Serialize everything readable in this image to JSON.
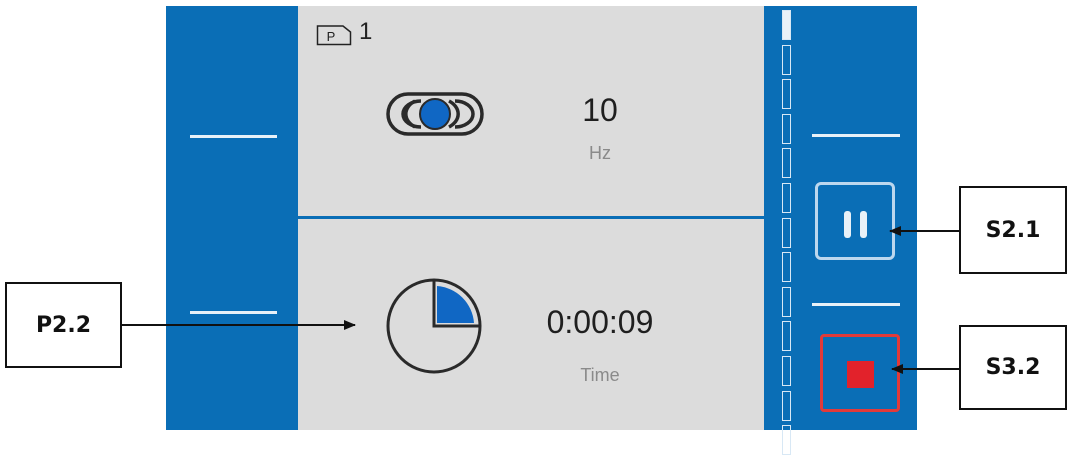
{
  "program": {
    "number": "1",
    "icon": "program-folder-icon",
    "icon_letter": "P"
  },
  "frequency": {
    "value": "10",
    "unit": "Hz",
    "icon": "vibration-mode-icon"
  },
  "time": {
    "value": "0:00:09",
    "unit": "Time",
    "icon": "timer-icon"
  },
  "segment_bar": {
    "total_segments": 13,
    "filled_segments": 1
  },
  "controls": {
    "pause_icon": "pause-icon",
    "stop_icon": "stop-icon"
  },
  "callouts": {
    "s2_1": "S2.1",
    "s3_2": "S3.2",
    "p2_2": "P2.2"
  },
  "colors": {
    "panel_blue": "#0a6eb6",
    "display_gray": "#dcdcdc",
    "stop_red": "#e2222b",
    "indicator_blue": "#1067c4"
  }
}
